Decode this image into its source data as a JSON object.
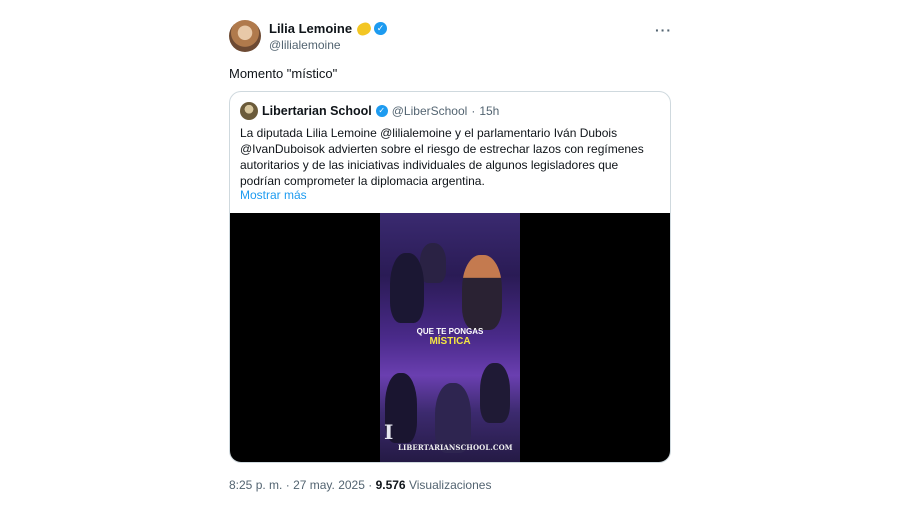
{
  "author": {
    "name": "Lilia Lemoine",
    "handle": "@lilialemoine"
  },
  "more_label": "···",
  "tweet_text": "Momento \"místico\"",
  "quote": {
    "name": "Libertarian School",
    "handle": "@LiberSchool",
    "separator": "·",
    "time": "15h",
    "text": "La diputada Lilia Lemoine @lilialemoine  y el parlamentario Iván Dubois @IvanDuboisok advierten sobre el riesgo de estrechar lazos con regímenes autoritarios y de las iniciativas individuales de algunos legisladores que podrían comprometer la diplomacia argentina.",
    "show_more": "Mostrar más",
    "video": {
      "caption_line1": "QUE TE PONGAS",
      "caption_line2": "MÍSTICA",
      "watermark": "LIBERTARIANSCHOOL.COM"
    }
  },
  "meta": {
    "time": "8:25 p. m.",
    "separator": "·",
    "date": "27 may. 2025",
    "views_count": "9.576",
    "views_label": "Visualizaciones"
  },
  "icons": {
    "verified": "verified-badge-icon",
    "lemon": "lemon-emoji-icon",
    "more": "more-options-icon"
  },
  "colors": {
    "accent": "#1d9bf0",
    "text_secondary": "#536471",
    "caption_yellow": "#f5e642"
  }
}
